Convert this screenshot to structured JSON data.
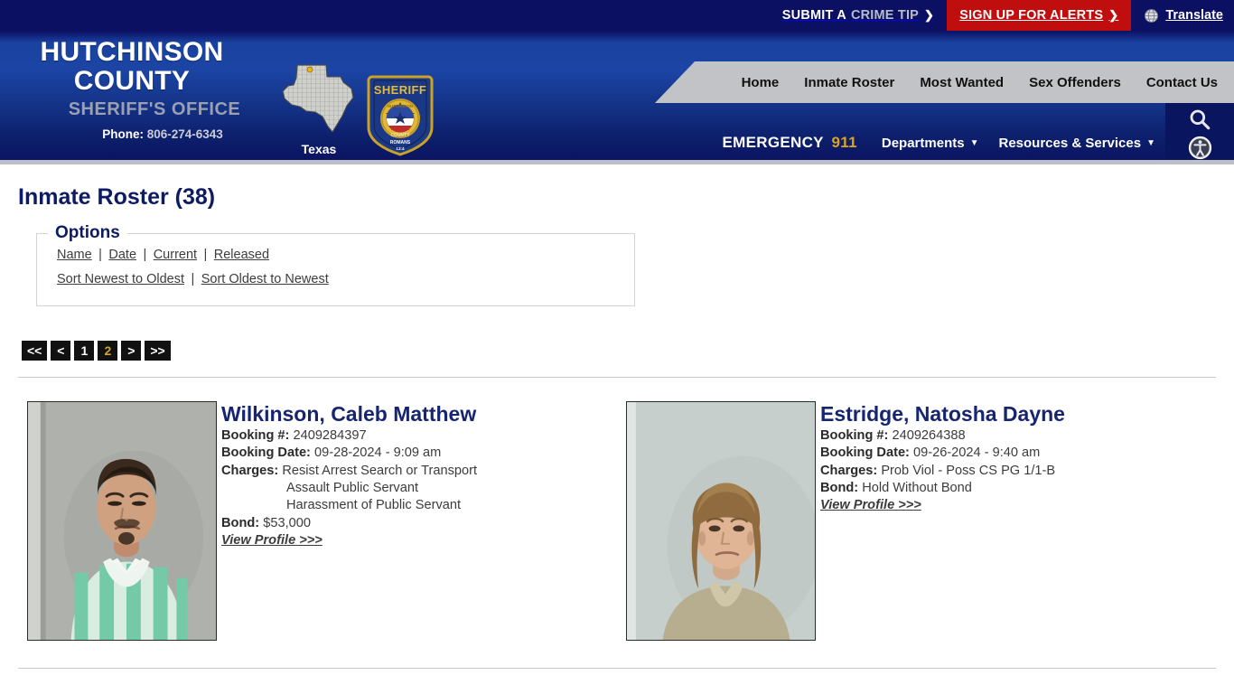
{
  "topbar": {
    "crime_tip_bold": "SUBMIT A",
    "crime_tip_light": "CRIME TIP",
    "crime_tip_chevron": "❯",
    "alerts_label": "SIGN UP FOR ALERTS",
    "alerts_chevron": "❯",
    "translate_label": "Translate",
    "globe_icon": "globe-icon",
    "alerts_bg_color": "#c00d0d",
    "topbar_bg_color": "#0b1063"
  },
  "header": {
    "county_name": "HUTCHINSON COUNTY",
    "office_name": "SHERIFF'S OFFICE",
    "phone_label": "Phone:",
    "phone_number": "806-274-6343",
    "state_label": "Texas",
    "badge_text_top": "SHERIFF",
    "badge_text_county_name": "HUTCHINSON",
    "badge_text_county": "COUNTY",
    "badge_text_verse": "ROMANS",
    "badge_text_verse_num": "13:4",
    "badge_star_text": "THE STATE OF TEXAS",
    "emergency_label": "EMERGENCY",
    "emergency_number": "911",
    "accent_gold": "#d9a520",
    "search_icon": "search-icon",
    "accessibility_icon": "accessibility-icon"
  },
  "nav": {
    "primary": [
      {
        "label": "Home"
      },
      {
        "label": "Inmate Roster"
      },
      {
        "label": "Most Wanted"
      },
      {
        "label": "Sex Offenders"
      },
      {
        "label": "Contact Us"
      }
    ],
    "secondary": [
      {
        "label": "Departments",
        "caret": "❯"
      },
      {
        "label": "Resources & Services",
        "caret": "❯"
      }
    ]
  },
  "main": {
    "page_title": "Inmate Roster (38)",
    "options": {
      "legend": "Options",
      "filter_links": [
        {
          "label": "Name"
        },
        {
          "label": "Date"
        },
        {
          "label": "Current"
        },
        {
          "label": "Released"
        }
      ],
      "sort_links": [
        {
          "label": "Sort Newest to Oldest"
        },
        {
          "label": "Sort Oldest to Newest"
        }
      ],
      "separator": "|"
    },
    "pagination": [
      {
        "label": "<<",
        "active": false
      },
      {
        "label": "<",
        "active": false
      },
      {
        "label": "1",
        "active": false
      },
      {
        "label": "2",
        "active": true
      },
      {
        "label": ">",
        "active": false
      },
      {
        "label": ">>",
        "active": false
      }
    ],
    "labels": {
      "booking_number": "Booking #:",
      "booking_date": "Booking Date:",
      "charges": "Charges:",
      "bond": "Bond:",
      "view_profile": "View Profile >>>"
    },
    "inmates": [
      {
        "name": "Wilkinson, Caleb Matthew",
        "booking_number": "2409284397",
        "booking_date": "09-28-2024 - 9:09 am",
        "charges": [
          "Resist Arrest Search or Transport",
          "Assault Public Servant",
          "Harassment of Public Servant"
        ],
        "bond": "$53,000",
        "mugshot": "mugshot-male-green-stripe-uniform"
      },
      {
        "name": "Estridge, Natosha Dayne",
        "booking_number": "2409264388",
        "booking_date": "09-26-2024 - 9:40 am",
        "charges": [
          "Prob Viol - Poss CS PG 1/1-B"
        ],
        "bond": "Hold Without Bond",
        "mugshot": "mugshot-female-tan-uniform"
      }
    ]
  }
}
